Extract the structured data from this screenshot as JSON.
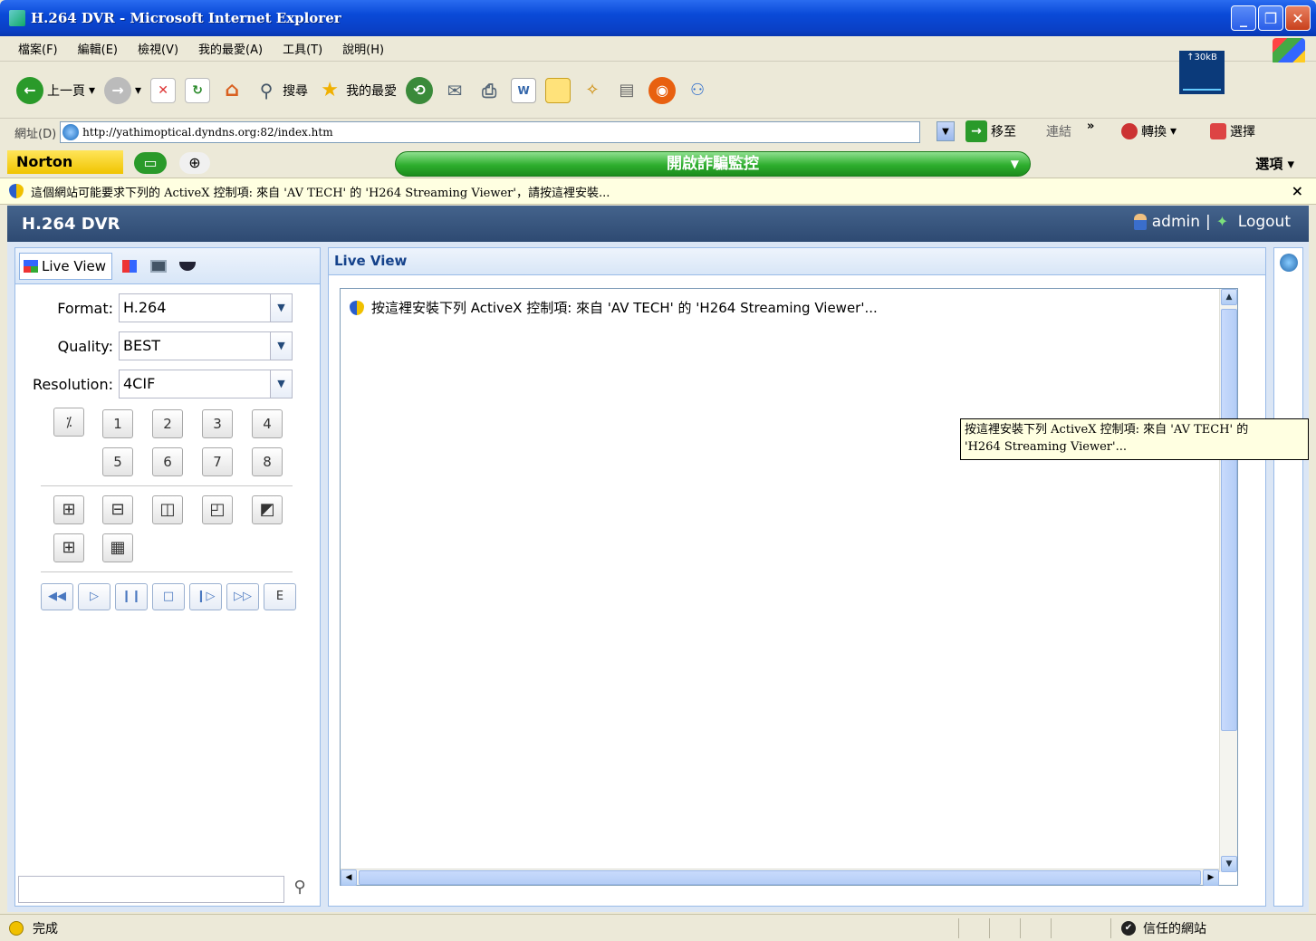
{
  "window": {
    "title": "H.264 DVR - Microsoft Internet Explorer",
    "minimize": "_",
    "restore": "❐",
    "close": "✕"
  },
  "menu": [
    "檔案(F)",
    "編輯(E)",
    "檢視(V)",
    "我的最愛(A)",
    "工具(T)",
    "說明(H)"
  ],
  "toolbar": {
    "back": "上一頁",
    "search": "搜尋",
    "favorites": "我的最愛",
    "net_meter": "↑30kB"
  },
  "address": {
    "label": "網址(D)",
    "url": "http://yathimoptical.dyndns.org:82/index.htm",
    "go": "移至",
    "links": "連結",
    "convert": "轉換",
    "select": "選擇"
  },
  "norton": {
    "logo": "Norton",
    "scam_monitor": "開啟詐騙監控",
    "options": "選項 ▾"
  },
  "infobar": {
    "message": "這個網站可能要求下列的 ActiveX 控制項: 來自 'AV TECH' 的 'H264 Streaming Viewer'，請按這裡安裝..."
  },
  "dvr": {
    "title": "H.264 DVR",
    "user": "admin",
    "logout": "Logout",
    "tab_live_view": "Live View",
    "format_label": "Format:",
    "format_value": "H.264",
    "quality_label": "Quality:",
    "quality_value": "BEST",
    "resolution_label": "Resolution:",
    "resolution_value": "4CIF",
    "channels": [
      "1",
      "2",
      "3",
      "4",
      "5",
      "6",
      "7",
      "8"
    ],
    "playback_e": "E",
    "panel_title": "Live View",
    "activex_message": "按這裡安裝下列 ActiveX 控制項: 來自 'AV TECH' 的 'H264 Streaming Viewer'..."
  },
  "tooltip": {
    "line1": "按這裡安裝下列 ActiveX 控制項: 來自 'AV TECH' 的",
    "line2": "'H264 Streaming Viewer'..."
  },
  "status": {
    "done": "完成",
    "zone": "信任的網站"
  }
}
